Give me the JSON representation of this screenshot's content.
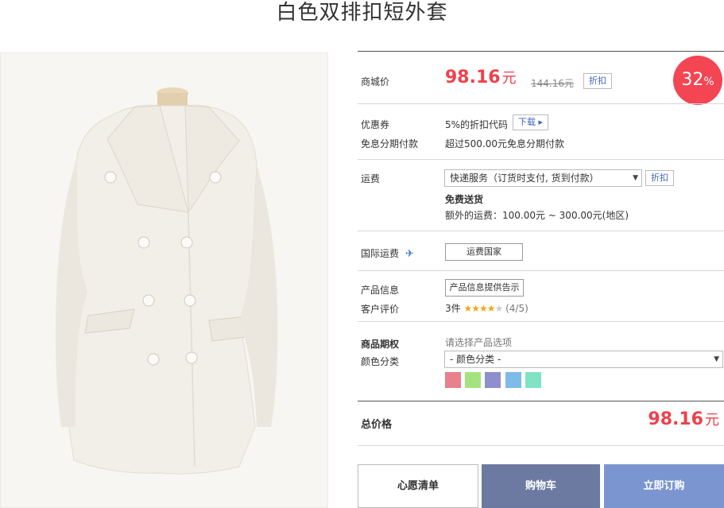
{
  "product": {
    "title": "白色双排扣短外套"
  },
  "price_section": {
    "label": "商城价",
    "price": "98.16",
    "currency": "元",
    "original_price": "144.16元",
    "discount_button": "折扣",
    "discount_badge_value": "32",
    "discount_badge_unit": "%"
  },
  "coupon": {
    "label": "优惠券",
    "value": "5%的折扣代码",
    "download_button": "下载 ▸",
    "installment_label": "免息分期付款",
    "installment_value": "超过500.00元免息分期付款"
  },
  "shipping": {
    "label": "运费",
    "selected_option": "快递服务（订货时支付, 货到付款）",
    "discount_button": "折扣",
    "free_shipping": "免费送货",
    "extra_fee": "额外的运费：100.00元 ~ 300.00元(地区)"
  },
  "international": {
    "label": "国际运费",
    "plane_icon": "plane-icon",
    "button": "运费国家"
  },
  "info": {
    "product_info_label": "产品信息",
    "product_info_button": "产品信息提供告示",
    "review_label": "客户评价",
    "review_count": "3件",
    "stars_filled": "★★★★",
    "stars_empty": "★",
    "rating": 4,
    "rating_text": "(4/5)"
  },
  "options": {
    "section_label": "商品期权",
    "prompt": "请选择产品选项",
    "color_label": "颜色分类",
    "color_select": "- 颜色分类 -",
    "swatches": [
      "#e8808e",
      "#a4e47e",
      "#8e8fcb",
      "#7dbbe9",
      "#7fe3c4"
    ]
  },
  "total": {
    "label": "总价格",
    "price": "98.16",
    "currency": "元"
  },
  "actions": {
    "wishlist": "心愿清单",
    "cart": "购物车",
    "buy_now": "立即订购"
  },
  "colors": {
    "accent_red": "#f0404b",
    "cart_button": "#6c7aa1",
    "buy_button": "#7b95d1"
  }
}
